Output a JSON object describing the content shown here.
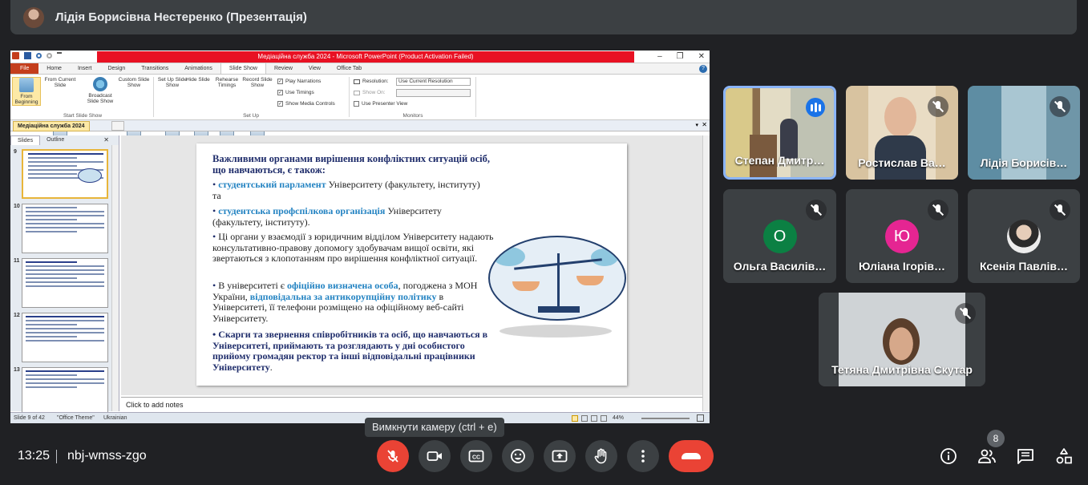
{
  "presenter": {
    "name": "Лідія Борисівна Нестеренко (Презентація)"
  },
  "ppt": {
    "window_title": "Медіаційна служба 2024  -  Microsoft PowerPoint (Product Activation Failed)",
    "tabs": [
      "File",
      "Home",
      "Insert",
      "Design",
      "Transitions",
      "Animations",
      "Slide Show",
      "Review",
      "View",
      "Office Tab"
    ],
    "active_tab": "Slide Show",
    "ribbon": {
      "from_beginning": "From Beginning",
      "from_current": "From Current Slide",
      "broadcast": "Broadcast Slide Show",
      "custom": "Custom Slide Show",
      "group_start": "Start Slide Show",
      "setup_show": "Set Up Slide Show",
      "hide_slide": "Hide Slide",
      "rehearse": "Rehearse Timings",
      "record": "Record Slide Show",
      "play_narrations": "Play Narrations",
      "use_timings": "Use Timings",
      "show_media": "Show Media Controls",
      "group_setup": "Set Up",
      "resolution_label": "Resolution:",
      "resolution_value": "Use Current Resolution",
      "show_on": "Show On:",
      "presenter_view": "Use Presenter View",
      "group_monitors": "Monitors"
    },
    "doc_tab": "Медіаційна служба 2024",
    "pane_tabs": [
      "Slides",
      "Outline"
    ],
    "thumb_numbers": [
      "9",
      "10",
      "11",
      "12",
      "13"
    ],
    "notes_placeholder": "Click to add notes",
    "status": {
      "slide": "Slide 9 of 42",
      "theme": "\"Office Theme\"",
      "language": "Ukrainian",
      "zoom": "44%"
    },
    "slide": {
      "heading": "Важливими органами вирішення  конфліктних  ситуацій осіб, що навчаються, є також:",
      "b1_hl": "студентський парламент",
      "b1_rest": " Університету  (факультету, інституту)  та",
      "b2_hl": "студентська профспілкова організація",
      "b2_rest": " Університету (факультету,  інституту).",
      "b3": "Ці органи у взаємодії з юридичним відділом Університету надають консультативно-правову  допомогу здобувачам вищої освіти, які звертаються з клопотанням про вирішення конфліктної ситуації.",
      "b4_a": " В університеті  є ",
      "b4_hl1": "офіційно визначена особа",
      "b4_b": ", погоджена з МОН України, ",
      "b4_hl2": "відповідальна за антикорупційну політику",
      "b4_c": " в Університеті, її телефони розміщено на офіційному веб-сайті Університету.",
      "b5": "Скарги та звернення співробітників  та осіб, що навчаються в Університеті,  приймають та розглядають у дні особистого прийому громадян ректор та інші відповідальні працівники Університету",
      "b5_end": ".",
      "bullet": "•"
    }
  },
  "tooltip": "Вимкнути камеру (ctrl + e)",
  "participants": [
    {
      "name": "Степан Дмитр…"
    },
    {
      "name": "Ростислав Ва…"
    },
    {
      "name": "Лідія Борисів…"
    },
    {
      "name": "Ольга Василів…",
      "initial": "О",
      "color": "#0b8043"
    },
    {
      "name": "Юліана Ігорів…",
      "initial": "Ю",
      "color": "#e52592"
    },
    {
      "name": "Ксенія Павлів…"
    },
    {
      "name": "Тетяна Дмитрівна Скутар"
    }
  ],
  "bottom": {
    "time": "13:25",
    "separator": "|",
    "meeting_code": "nbj-wmss-zgo",
    "participant_count": "8"
  },
  "colors": {
    "end_call": "#ea4335",
    "mic_off": "#ea4335",
    "speaking": "#1a73e8"
  }
}
